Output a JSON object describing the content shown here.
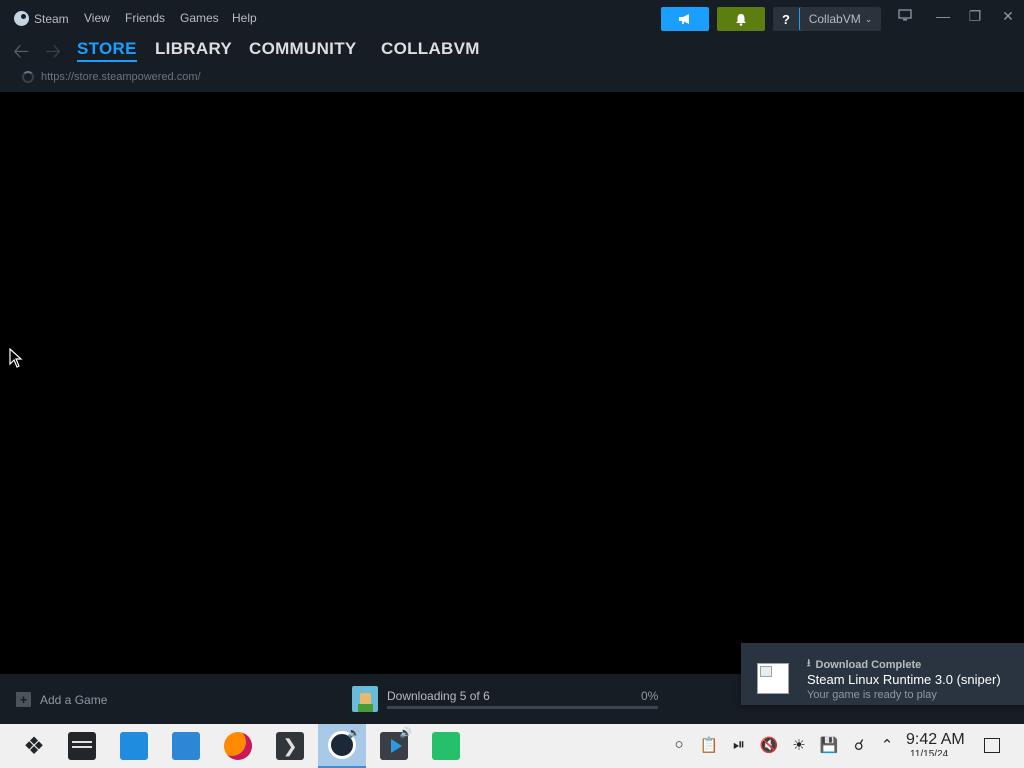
{
  "menubar": {
    "items": [
      "Steam",
      "View",
      "Friends",
      "Games",
      "Help"
    ],
    "help_btn": "?",
    "account_name": "CollabVM",
    "announce_icon": "megaphone-icon",
    "notify_icon": "bell-icon",
    "colors": {
      "announce": "#1a9fff",
      "notify": "#5c7e10"
    }
  },
  "nav": {
    "tabs": [
      "STORE",
      "LIBRARY",
      "COMMUNITY",
      "COLLABVM"
    ],
    "active_tab": "STORE",
    "url": "https://store.steampowered.com/"
  },
  "bottombar": {
    "add_game": "Add a Game",
    "download_status": "Downloading 5 of 6",
    "download_percent": "0%",
    "progress": 0
  },
  "toast": {
    "title": "Download Complete",
    "message": "Steam Linux Runtime 3.0 (sniper)",
    "subtitle": "Your game is ready to play"
  },
  "taskbar": {
    "apps": [
      "app-launcher",
      "system-settings",
      "discover",
      "dolphin",
      "firefox",
      "konsole",
      "steam",
      "kdenlive",
      "kate"
    ],
    "active_app": "steam",
    "time": "9:42 AM",
    "date": "11/15/24"
  },
  "colors": {
    "accent": "#1a9fff",
    "chrome_bg": "#171d25",
    "content_bg": "#000000",
    "taskbar_bg": "#f0f0f0"
  }
}
